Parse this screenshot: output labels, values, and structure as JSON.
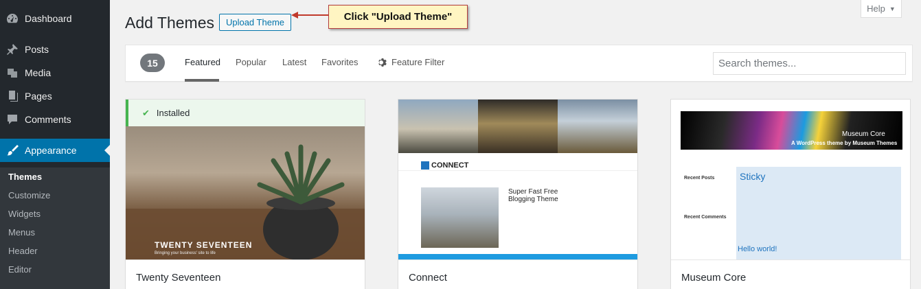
{
  "sidebar": {
    "items": [
      {
        "label": "Dashboard",
        "icon": "dashboard-icon"
      },
      {
        "label": "Posts",
        "icon": "pin-icon"
      },
      {
        "label": "Media",
        "icon": "media-icon"
      },
      {
        "label": "Pages",
        "icon": "pages-icon"
      },
      {
        "label": "Comments",
        "icon": "comment-icon"
      },
      {
        "label": "Appearance",
        "icon": "paintbrush-icon"
      }
    ],
    "submenu": [
      "Themes",
      "Customize",
      "Widgets",
      "Menus",
      "Header",
      "Editor"
    ]
  },
  "header": {
    "title": "Add Themes",
    "upload_label": "Upload Theme",
    "callout": "Click \"Upload Theme\"",
    "help_label": "Help"
  },
  "filter": {
    "count": "15",
    "tabs": [
      "Featured",
      "Popular",
      "Latest",
      "Favorites"
    ],
    "feature_filter": "Feature Filter",
    "search_placeholder": "Search themes..."
  },
  "themes": [
    {
      "name": "Twenty Seventeen",
      "installed_label": "Installed",
      "preview_title": "TWENTY SEVENTEEN",
      "preview_sub": "Bringing your business' site to life"
    },
    {
      "name": "Connect",
      "preview_logo": "CONNECT",
      "preview_headline": "Super Fast Free Blogging Theme"
    },
    {
      "name": "Museum Core",
      "preview_title": "Museum Core",
      "preview_sub": "A WordPress theme by Museum Themes",
      "preview_sidebar_1": "Recent Posts",
      "preview_sidebar_2": "Recent Comments",
      "preview_sticky": "Sticky",
      "preview_hello": "Hello world!"
    }
  ],
  "colors": {
    "sidebar_bg": "#23282d",
    "active_menu": "#0073aa",
    "installed_green": "#46b450",
    "callout_bg": "#fff5c2",
    "callout_border": "#b23a3a"
  }
}
